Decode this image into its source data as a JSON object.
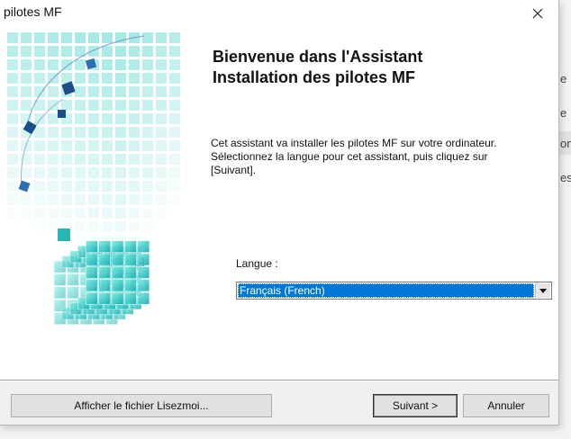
{
  "window": {
    "title": "pilotes MF",
    "close_icon": "close-icon"
  },
  "background": {
    "fragments": [
      "e",
      "e",
      "on",
      "es"
    ]
  },
  "wizard": {
    "heading_line1": "Bienvenue dans l'Assistant",
    "heading_line2": "Installation des pilotes MF",
    "desc_line1": "Cet assistant va installer les pilotes MF sur votre ordinateur.",
    "desc_line2": "Sélectionnez la langue pour cet assistant, puis cliquez sur",
    "desc_line3": "[Suivant].",
    "language_label": "Langue :",
    "language_selected": "Français (French)",
    "colors": {
      "accent": "#0078d7",
      "art_teal": "#2fc9c0",
      "art_dark_blue": "#1b4f8a"
    }
  },
  "buttons": {
    "readme": "Afficher le fichier Lisezmoi...",
    "next": "Suivant >",
    "cancel": "Annuler"
  }
}
